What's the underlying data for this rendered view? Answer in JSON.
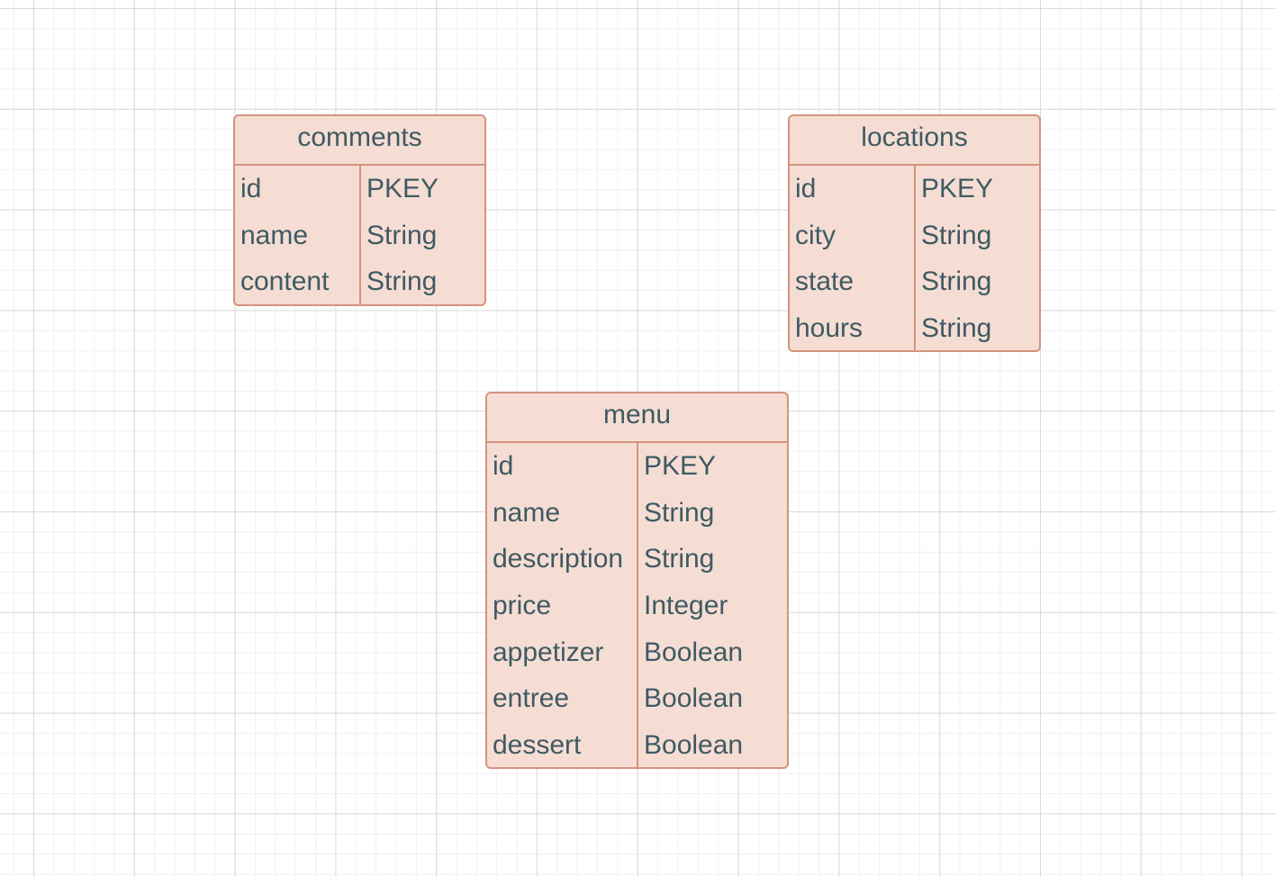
{
  "diagram": {
    "entities": [
      {
        "key": "comments",
        "title": "comments",
        "rows": [
          {
            "field": "id",
            "type": "PKEY"
          },
          {
            "field": "name",
            "type": "String"
          },
          {
            "field": "content",
            "type": "String"
          }
        ]
      },
      {
        "key": "locations",
        "title": "locations",
        "rows": [
          {
            "field": "id",
            "type": "PKEY"
          },
          {
            "field": "city",
            "type": "String"
          },
          {
            "field": "state",
            "type": "String"
          },
          {
            "field": "hours",
            "type": "String"
          }
        ]
      },
      {
        "key": "menu",
        "title": "menu",
        "rows": [
          {
            "field": "id",
            "type": "PKEY"
          },
          {
            "field": "name",
            "type": "String"
          },
          {
            "field": "description",
            "type": "String"
          },
          {
            "field": "price",
            "type": "Integer"
          },
          {
            "field": "appetizer",
            "type": "Boolean"
          },
          {
            "field": "entree",
            "type": "Boolean"
          },
          {
            "field": "dessert",
            "type": "Boolean"
          }
        ]
      }
    ],
    "colors": {
      "fill": "#f5ddd4",
      "border": "#d4947e",
      "text": "#3f5a63"
    }
  }
}
